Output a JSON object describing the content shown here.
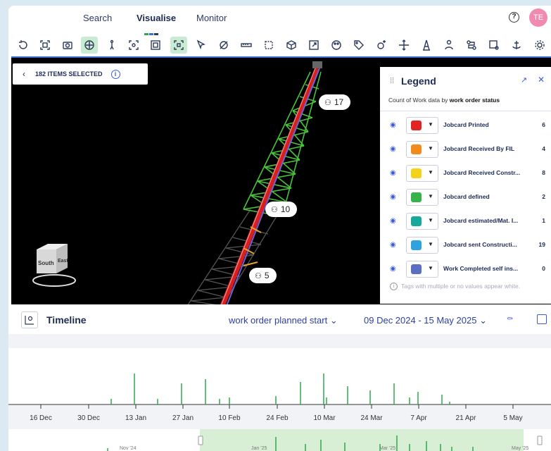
{
  "nav": {
    "tabs": [
      "Search",
      "Visualise",
      "Monitor"
    ],
    "active": "Visualise",
    "underline_colors": [
      "#2ea84a",
      "#3a6fd8",
      "#e2463b",
      "#2b3a67"
    ],
    "help_icon": "help-circle-icon",
    "avatar_initials": "TE",
    "avatar_color": "#f08ab0"
  },
  "toolbar": {
    "icons": [
      "undo-icon",
      "fit-view-icon",
      "camera-icon",
      "navigate-icon",
      "walk-icon",
      "focus-icon",
      "isolate-icon",
      "section-box-icon",
      "select-arrow-icon",
      "hide-icon",
      "measure-icon",
      "box-select-icon",
      "cube-icon",
      "export-icon",
      "palette-icon",
      "tag-icon",
      "settings-plus-icon",
      "move-icon",
      "tower-icon",
      "person-icon",
      "route-icon",
      "zoom-box-icon",
      "anchor-icon",
      "gear-icon"
    ],
    "active_indices": [
      3,
      7
    ]
  },
  "viewport": {
    "selection_label": "182 ITEMS SELECTED",
    "pins": [
      "17",
      "10",
      "5"
    ],
    "cube_faces": [
      "South",
      "East"
    ]
  },
  "legend": {
    "title": "Legend",
    "subtitle_prefix": "Count of Work data by ",
    "subtitle_field": "work order status",
    "items": [
      {
        "label": "Jobcard Printed",
        "count": "6",
        "color": "#e02424"
      },
      {
        "label": "Jobcard Received By FIL",
        "count": "4",
        "color": "#f28a1c"
      },
      {
        "label": "Jobcard Received Constr...",
        "count": "8",
        "color": "#f5d21a"
      },
      {
        "label": "Jobcard defined",
        "count": "2",
        "color": "#37b34a"
      },
      {
        "label": "Jobcard estimated/Mat. I...",
        "count": "1",
        "color": "#16a89a"
      },
      {
        "label": "Jobcard sent Constructi...",
        "count": "19",
        "color": "#2ea3e0"
      },
      {
        "label": "Work Completed self ins...",
        "count": "0",
        "color": "#5a6fc4"
      }
    ],
    "footnote": "Tags with multiple or no values appear white."
  },
  "timeline": {
    "title": "Timeline",
    "field": "work order planned start",
    "range": "09 Dec 2024 - 15 May 2025",
    "ticks": [
      "16 Dec",
      "30 Dec",
      "13 Jan",
      "27 Jan",
      "10 Feb",
      "24 Feb",
      "10 Mar",
      "24 Mar",
      "7 Apr",
      "21 Apr",
      "5 May"
    ],
    "overview_labels": [
      "Nov '24",
      "Jan '25",
      "Mar '25",
      "May '25"
    ],
    "bar_color": "#2ea84a"
  }
}
